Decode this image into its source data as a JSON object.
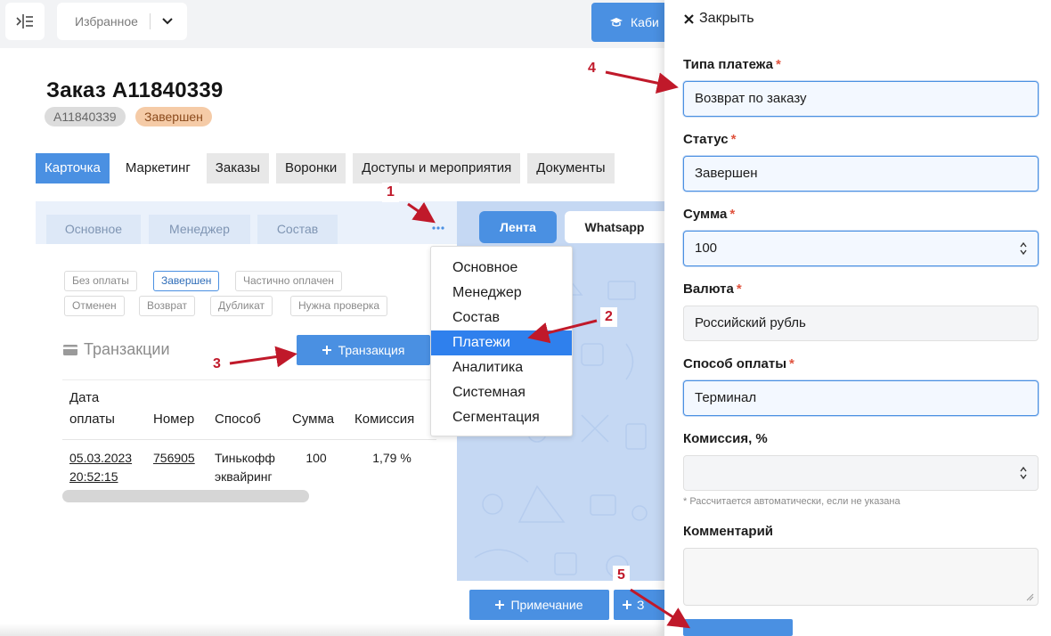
{
  "topbar": {
    "favorites_label": "Избранное",
    "cabinet_label": "Каби"
  },
  "order": {
    "title": "Заказ А11840339",
    "id_badge": "А11840339",
    "status_badge": "Завершен"
  },
  "tabs": [
    {
      "label": "Карточка",
      "active": true
    },
    {
      "label": "Маркетинг",
      "active": false
    },
    {
      "label": "Заказы",
      "active": false
    },
    {
      "label": "Воронки",
      "active": false
    },
    {
      "label": "Доступы и мероприятия",
      "active": false
    },
    {
      "label": "Документы",
      "active": false
    }
  ],
  "subtabs": [
    "Основное",
    "Менеджер",
    "Состав"
  ],
  "filters": [
    "Без оплаты",
    "Завершен",
    "Частично оплачен",
    "Отменен",
    "Возврат",
    "Дубликат",
    "Нужна проверка"
  ],
  "active_filter": "Завершен",
  "transactions": {
    "heading": "Транзакции",
    "add_button": "Транзакция",
    "columns": [
      "Дата оплаты",
      "Номер",
      "Способ",
      "Сумма",
      "Комиссия"
    ],
    "rows": [
      {
        "date": "05.03.2023 20:52:15",
        "number": "756905",
        "method": "Тинькофф эквайринг",
        "amount": "100",
        "commission": "1,79 %"
      }
    ]
  },
  "dropdown": {
    "items": [
      "Основное",
      "Менеджер",
      "Состав",
      "Платежи",
      "Аналитика",
      "Системная",
      "Сегментация"
    ],
    "active_item": "Платежи"
  },
  "feed": {
    "tabs": [
      "Лента",
      "Whatsapp"
    ],
    "note_button": "Примечание",
    "second_button": "З"
  },
  "drawer": {
    "close_label": "Закрыть",
    "payment_type_label": "Типа платежа",
    "payment_type_value": "Возврат по заказу",
    "status_label": "Статус",
    "status_value": "Завершен",
    "amount_label": "Сумма",
    "amount_value": "100",
    "currency_label": "Валюта",
    "currency_value": "Российский рубль",
    "method_label": "Способ оплаты",
    "method_value": "Терминал",
    "commission_label": "Комиссия, %",
    "commission_value": "",
    "hint": "* Рассчитается автоматически, если не указана",
    "comment_label": "Комментарий",
    "required_mark": "*"
  },
  "callouts": [
    "1",
    "2",
    "3",
    "4",
    "5"
  ],
  "colors": {
    "accent": "#4a90e2",
    "callout": "#c0192a",
    "status_badge_bg": "#f5cba7",
    "dropdown_active": "#2f80ed"
  }
}
